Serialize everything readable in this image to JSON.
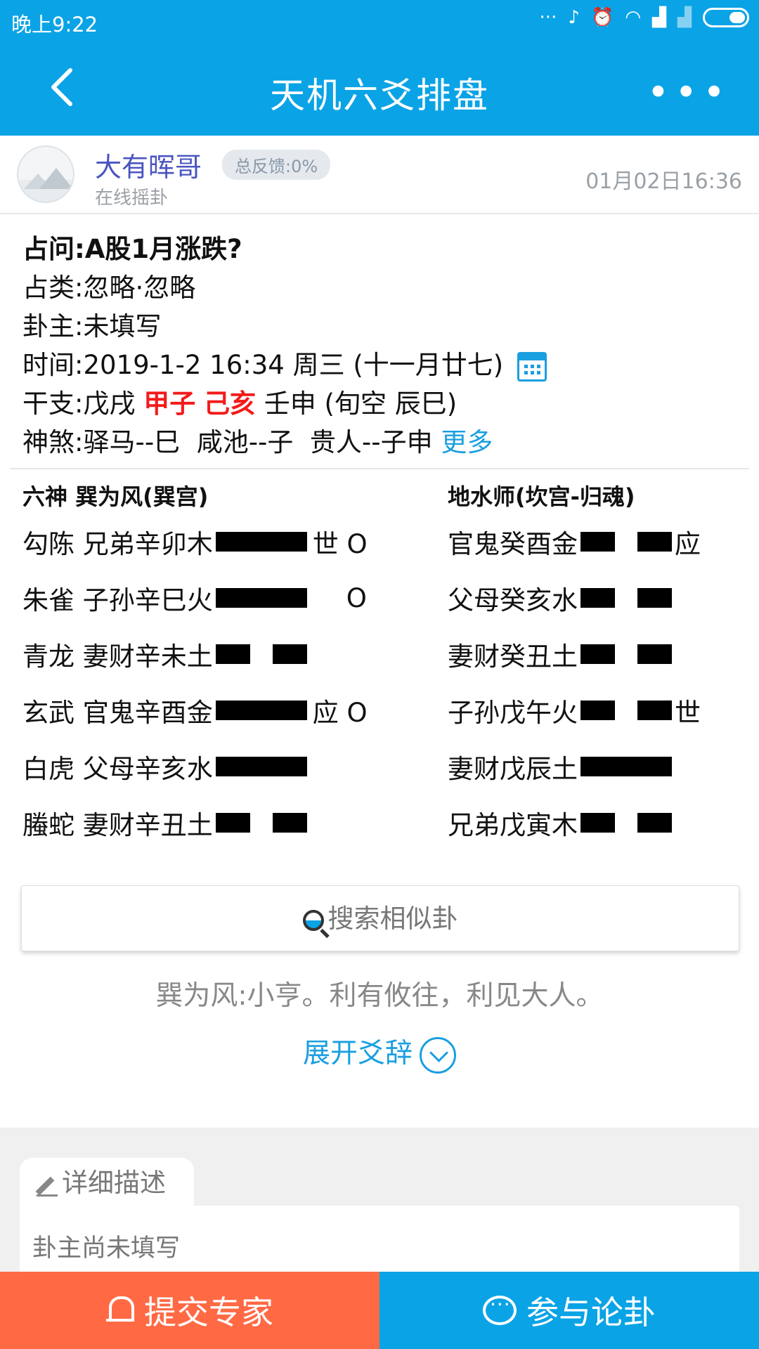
{
  "status": {
    "time": "晚上9:22",
    "icons": [
      "more-dots-icon",
      "vibrate-icon",
      "alarm-icon",
      "wifi-icon",
      "signal-icon",
      "signal-off-icon",
      "battery-icon"
    ]
  },
  "header": {
    "title": "天机六爻排盘",
    "back_icon": "back-chevron-icon",
    "more_icon": "more-icon",
    "more_symbol": "•••"
  },
  "user": {
    "name": "大有晖哥",
    "badge": "总反馈:0%",
    "subtitle": "在线摇卦",
    "date": "01月02日16:36"
  },
  "info": {
    "question_label": "占问:",
    "question": "A股1月涨跌?",
    "category_label": "占类:",
    "category": "忽略·忽略",
    "owner_label": "卦主:",
    "owner": "未填写",
    "time_label": "时间:",
    "time": "2019-1-2 16:34 周三 (十一月廿七)",
    "ganzhi_label": "干支:",
    "ganzhi_1": "戊戌",
    "ganzhi_2": "甲子",
    "ganzhi_3": "己亥",
    "ganzhi_4": "壬申 (旬空 辰巳)",
    "shensha_label": "神煞:",
    "shensha": "驿马--巳  咸池--子  贵人--子申",
    "more": "更多"
  },
  "left_hex": {
    "header": "六神 巽为风(巽宫)",
    "lines": [
      {
        "text": "勾陈 兄弟辛卯木",
        "yang": true,
        "mark": "世 O"
      },
      {
        "text": "朱雀 子孙辛巳火",
        "yang": true,
        "mark": "O"
      },
      {
        "text": "青龙 妻财辛未土",
        "yang": false,
        "mark": ""
      },
      {
        "text": "玄武 官鬼辛酉金",
        "yang": true,
        "mark": "应 O"
      },
      {
        "text": "白虎 父母辛亥水",
        "yang": true,
        "mark": ""
      },
      {
        "text": "螣蛇 妻财辛丑土",
        "yang": false,
        "mark": ""
      }
    ]
  },
  "right_hex": {
    "header": "地水师(坎宫-归魂)",
    "lines": [
      {
        "text": "官鬼癸酉金",
        "yang": false,
        "mark": "应"
      },
      {
        "text": "父母癸亥水",
        "yang": false,
        "mark": ""
      },
      {
        "text": "妻财癸丑土",
        "yang": false,
        "mark": ""
      },
      {
        "text": "子孙戊午火",
        "yang": false,
        "mark": "世"
      },
      {
        "text": "妻财戊辰土",
        "yang": true,
        "mark": ""
      },
      {
        "text": "兄弟戊寅木",
        "yang": false,
        "mark": ""
      }
    ]
  },
  "search": {
    "label": "搜索相似卦",
    "icon": "search-icon"
  },
  "summary": "巽为风:小亨。利有攸往，利见大人。",
  "expand": {
    "label": "展开爻辞",
    "icon": "chevron-down-circle-icon"
  },
  "detail": {
    "tab_label": "详细描述",
    "icon": "pencil-icon",
    "text": "卦主尚未填写"
  },
  "footer": {
    "submit_label": "提交专家",
    "submit_icon": "bell-icon",
    "discuss_label": "参与论卦",
    "discuss_icon": "chat-icon"
  },
  "colors": {
    "primary": "#0aa3e6",
    "accent_orange": "#ff6a45",
    "red": "#f21b1b",
    "link_blue": "#1a9fe0"
  }
}
